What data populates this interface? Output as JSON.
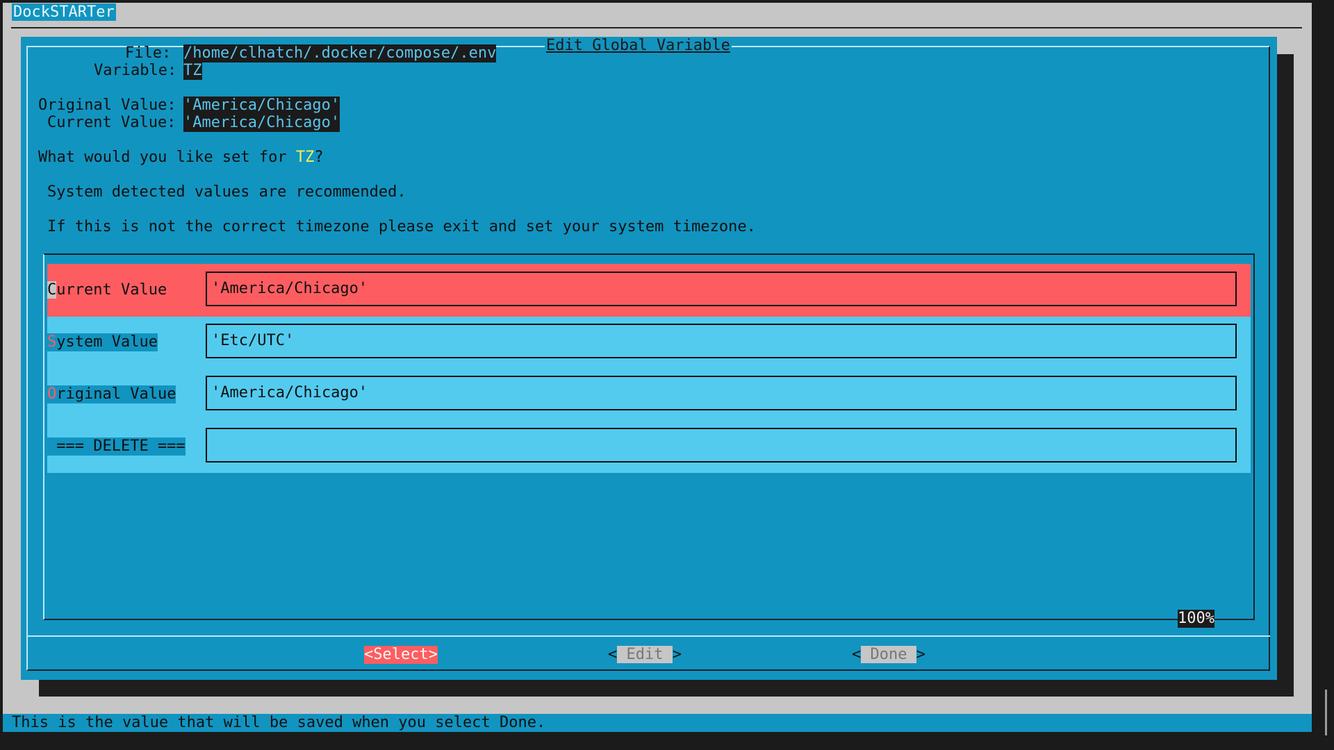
{
  "app": {
    "title": "DockSTARTer"
  },
  "dialog": {
    "title": "Edit Global Variable",
    "file_label": "File:",
    "file_value": "/home/clhatch/.docker/compose/.env",
    "variable_label": "Variable:",
    "variable_value": "TZ",
    "original_label": "Original Value:",
    "original_value": "'America/Chicago'",
    "current_label": "Current Value:",
    "current_value": "'America/Chicago'",
    "question_prefix": "What would you like set for ",
    "question_var": "TZ",
    "question_suffix": "?",
    "note1": "System detected values are recommended.",
    "note2": "If this is not the correct timezone please exit and set your system timezone."
  },
  "form": {
    "rows": [
      {
        "hotkey": "C",
        "rest": "urrent Value",
        "value": "'America/Chicago'",
        "selected": true
      },
      {
        "hotkey": "S",
        "rest": "ystem Value",
        "value": "'Etc/UTC'",
        "selected": false
      },
      {
        "hotkey": "O",
        "rest": "riginal Value",
        "value": "'America/Chicago'",
        "selected": false
      },
      {
        "hotkey": "",
        "rest": " === DELETE ===",
        "value": "",
        "selected": false
      }
    ],
    "scroll_percent": "100%"
  },
  "buttons": {
    "select": "<Select>",
    "edit_left": "<",
    "edit": " Edit ",
    "edit_right": ">",
    "done_left": "<",
    "done": " Done ",
    "done_right": ">"
  },
  "status": {
    "text": "This is the value that will be saved when you select Done."
  },
  "colors": {
    "dialog_bg": "#1294c0",
    "list_bg": "#52cbef",
    "selected_bg": "#fd5d60",
    "screen_bg": "#c6c6c6"
  }
}
